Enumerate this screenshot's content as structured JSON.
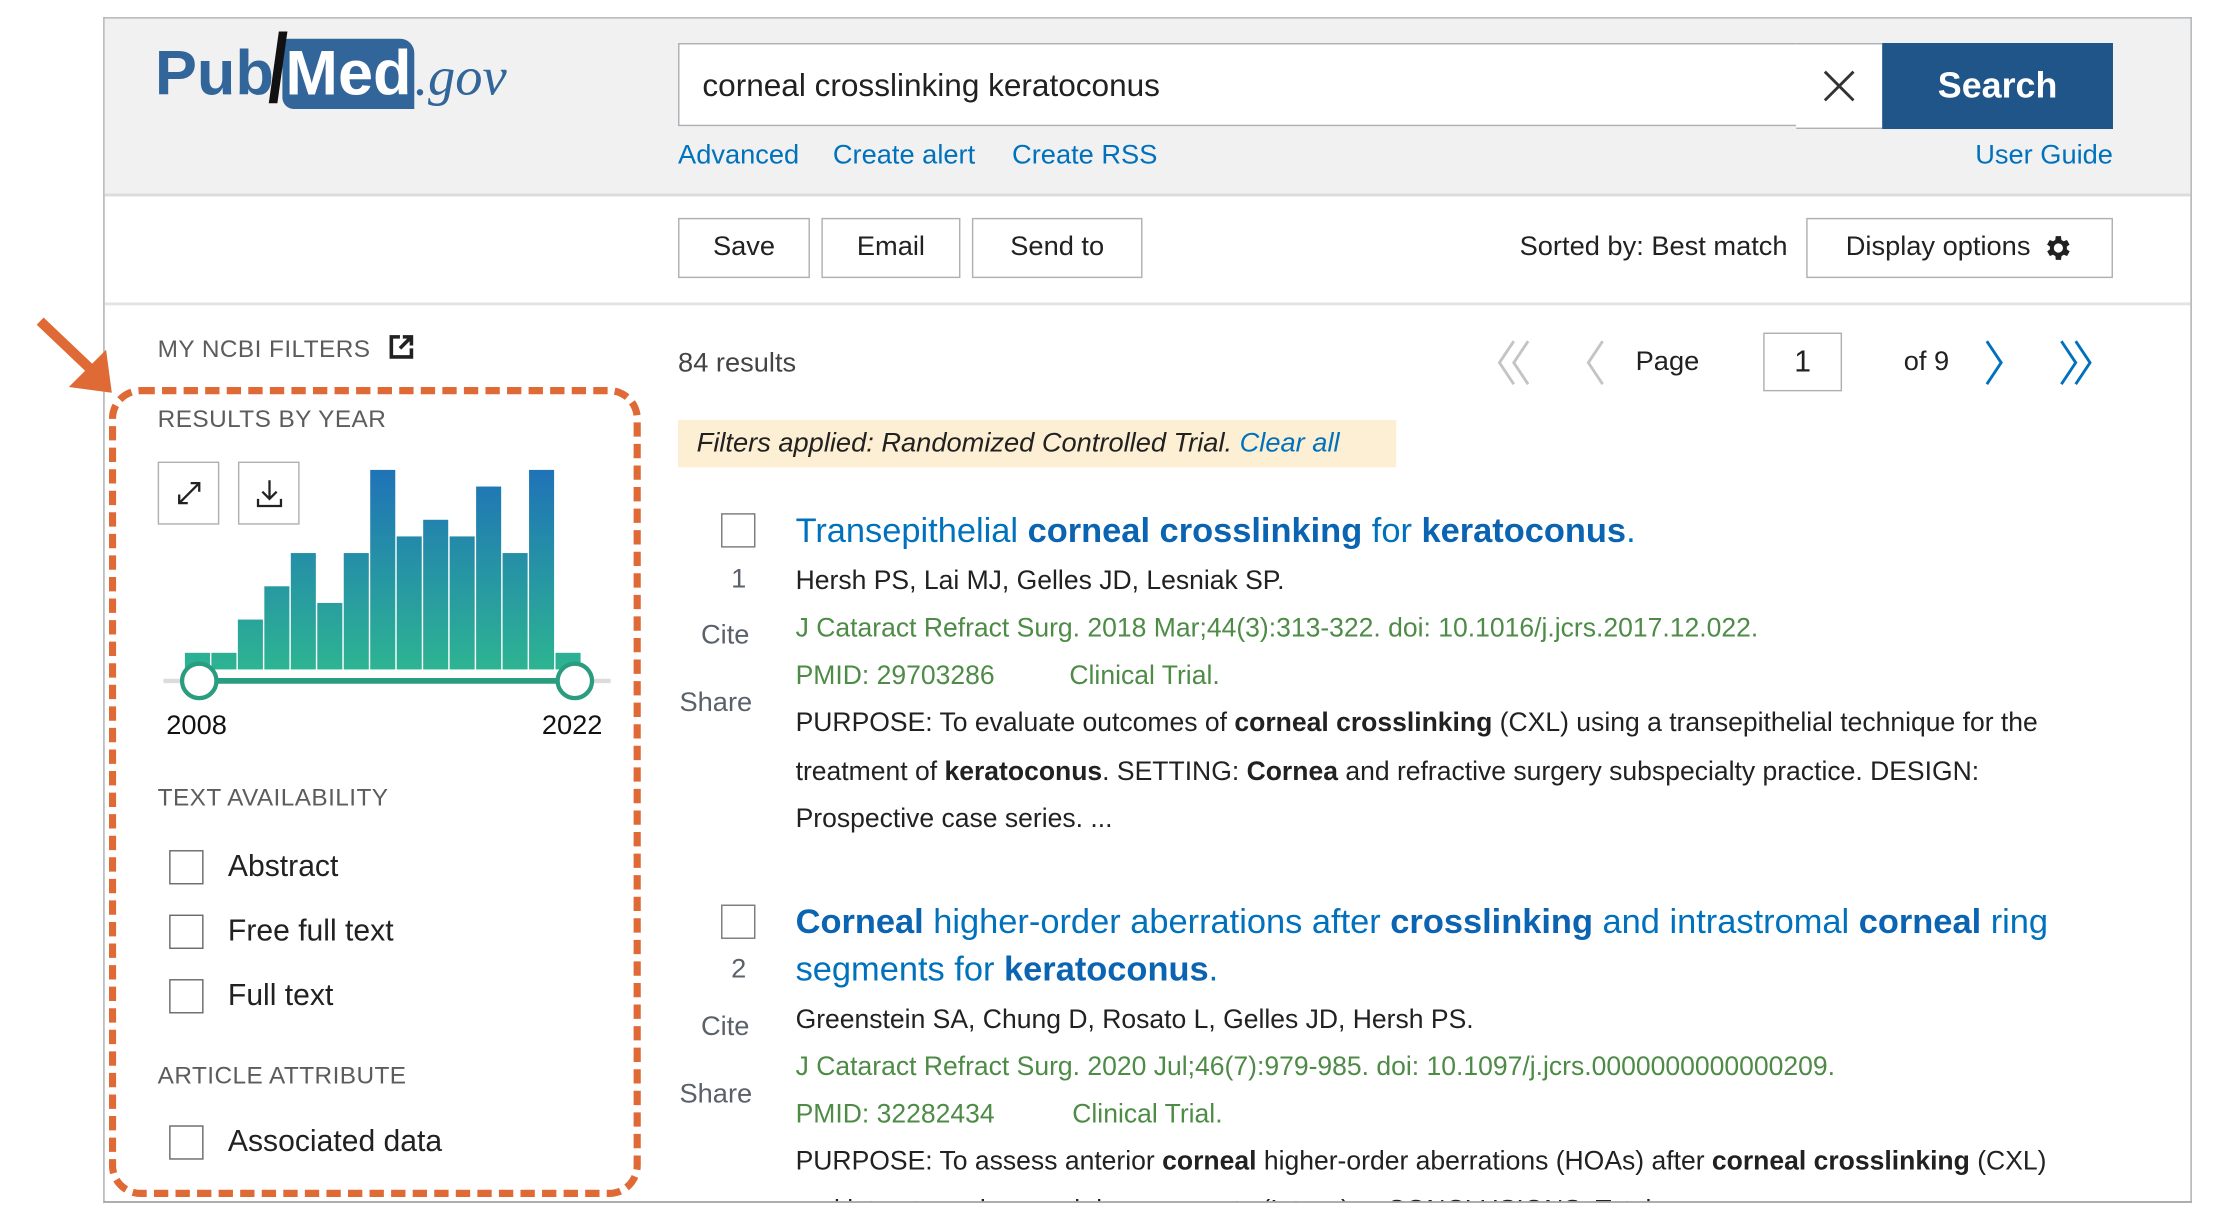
{
  "header": {
    "logo": {
      "pub": "Pub",
      "med": "Med",
      "gov": ".gov"
    },
    "search": {
      "value": "corneal crosslinking keratoconus",
      "clear_icon": "close-icon",
      "button": "Search"
    },
    "links": {
      "advanced": "Advanced",
      "create_alert": "Create alert",
      "create_rss": "Create RSS",
      "user_guide": "User Guide"
    }
  },
  "toolbar": {
    "save": "Save",
    "email": "Email",
    "send_to": "Send to",
    "sorted_by": "Sorted by: Best match",
    "display_options": "Display options",
    "display_icon": "gear-icon"
  },
  "sidebar": {
    "my_ncbi_filters": "MY NCBI FILTERS",
    "results_by_year": "RESULTS BY YEAR",
    "expand_icon": "expand-icon",
    "download_icon": "download-icon",
    "range_start": "2008",
    "range_end": "2022",
    "text_availability": {
      "heading": "TEXT AVAILABILITY",
      "options": [
        {
          "label": "Abstract",
          "checked": false
        },
        {
          "label": "Free full text",
          "checked": false
        },
        {
          "label": "Full text",
          "checked": false
        }
      ]
    },
    "article_attribute": {
      "heading": "ARTICLE ATTRIBUTE",
      "options": [
        {
          "label": "Associated data",
          "checked": false
        }
      ]
    },
    "highlight_color": "#e06a35"
  },
  "chart_data": {
    "type": "bar",
    "categories": [
      "2008",
      "2009",
      "2010",
      "2011",
      "2012",
      "2013",
      "2014",
      "2015",
      "2016",
      "2017",
      "2018",
      "2019",
      "2020",
      "2021",
      "2022"
    ],
    "values": [
      1,
      1,
      3,
      5,
      7,
      4,
      7,
      12,
      8,
      9,
      8,
      11,
      7,
      12,
      1
    ],
    "colors": {
      "bottom": "#2db492",
      "top": "#1f73b7"
    },
    "selected_range": [
      "2008",
      "2022"
    ]
  },
  "results": {
    "count": "84 results",
    "pagination": {
      "page_label": "Page",
      "page": "1",
      "of": "of 9"
    },
    "filters": {
      "text": "Filters applied: Randomized Controlled Trial.",
      "clear": "Clear all"
    },
    "items": [
      {
        "number": "1",
        "title": [
          {
            "t": "Transepithelial ",
            "b": false
          },
          {
            "t": "corneal crosslinking",
            "b": true
          },
          {
            "t": " for ",
            "b": false
          },
          {
            "t": "keratoconus",
            "b": true
          },
          {
            "t": ".",
            "b": false
          }
        ],
        "authors": "Hersh PS, Lai MJ, Gelles JD, Lesniak SP.",
        "journal": "J Cataract Refract Surg. 2018 Mar;44(3):313-322. doi: 10.1016/j.jcrs.2017.12.022.",
        "pmid": "PMID: 29703286",
        "type": "Clinical Trial.",
        "abstract": [
          {
            "t": "PURPOSE: To evaluate outcomes of ",
            "b": false
          },
          {
            "t": "corneal crosslinking",
            "b": true
          },
          {
            "t": " (CXL) using a transepithelial technique for the treatment of ",
            "b": false
          },
          {
            "t": "keratoconus",
            "b": true
          },
          {
            "t": ". SETTING: ",
            "b": false
          },
          {
            "t": "Cornea",
            "b": true
          },
          {
            "t": " and refractive surgery subspecialty practice. DESIGN: Prospective case series. ...",
            "b": false
          }
        ],
        "cite": "Cite",
        "share": "Share"
      },
      {
        "number": "2",
        "title": [
          {
            "t": "Corneal",
            "b": true
          },
          {
            "t": " higher-order aberrations after ",
            "b": false
          },
          {
            "t": "crosslinking",
            "b": true
          },
          {
            "t": " and intrastromal ",
            "b": false
          },
          {
            "t": "corneal",
            "b": true
          },
          {
            "t": " ring segments for ",
            "b": false
          },
          {
            "t": "keratoconus",
            "b": true
          },
          {
            "t": ".",
            "b": false
          }
        ],
        "authors": "Greenstein SA, Chung D, Rosato L, Gelles JD, Hersh PS.",
        "journal": "J Cataract Refract Surg. 2020 Jul;46(7):979-985. doi: 10.1097/j.jcrs.0000000000000209.",
        "pmid": "PMID: 32282434",
        "type": "Clinical Trial.",
        "abstract": [
          {
            "t": "PURPOSE: To assess anterior ",
            "b": false
          },
          {
            "t": "corneal",
            "b": true
          },
          {
            "t": " higher-order aberrations (HOAs) after ",
            "b": false
          },
          {
            "t": "corneal crosslinking",
            "b": true
          },
          {
            "t": " (CXL) and intrastromal corneal ring segments (Intacs) ... CONCLUSIONS: Total",
            "b": false
          }
        ],
        "cite": "Cite",
        "share": "Share"
      }
    ]
  }
}
